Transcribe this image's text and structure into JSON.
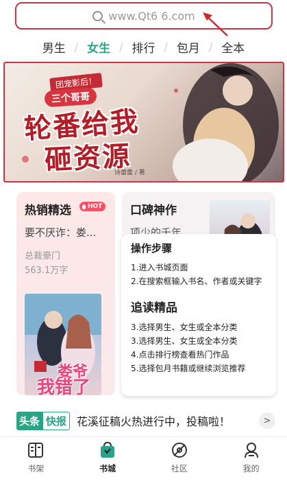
{
  "search": {
    "text": "www.Qt6  6.com"
  },
  "tabs": [
    {
      "label": "男生",
      "active": false
    },
    {
      "label": "女生",
      "active": true
    },
    {
      "label": "排行",
      "active": false
    },
    {
      "label": "包月",
      "active": false
    },
    {
      "label": "全本",
      "active": false
    }
  ],
  "tab_separator": "/",
  "banner": {
    "tag": "团宠影后！",
    "subtitle": "三个哥哥",
    "title_line1": "轮番给我",
    "title_line2": "砸资源",
    "author": "诗蕾蕾 / 著"
  },
  "hot_sales": {
    "title": "热销精选",
    "badge": "HOT",
    "book_title": "要不厌诈：娄...",
    "category": "总裁豪门",
    "word_count": "563.1万字",
    "cover_text_1": "娄爷",
    "cover_text_2": "我错了"
  },
  "word_of_mouth": {
    "title": "口碑神作",
    "book_title": "项少的千年..."
  },
  "guide_panel": {
    "heading1": "操作步骤",
    "steps1": [
      "1.进入书城页面",
      "2.在搜索框输入书名、作者或关键字"
    ],
    "heading2": "追读精品",
    "steps2": [
      "3.选择男生、女生或全本分类",
      "3.选择男生、女生或全本分类",
      "4.点击排行榜查看热门作品",
      "5.选择包月书籍或继续浏览推荐"
    ]
  },
  "news": {
    "badge_1": "头条",
    "badge_2": "快报",
    "text": "花溪征稿火热进行中，投稿啦！",
    "more": ">"
  },
  "bottom_nav": [
    {
      "label": "书架",
      "icon": "bookshelf-icon",
      "active": false
    },
    {
      "label": "书城",
      "icon": "bookstore-icon",
      "active": true
    },
    {
      "label": "社区",
      "icon": "community-icon",
      "active": false
    },
    {
      "label": "我的",
      "icon": "profile-icon",
      "active": false
    }
  ],
  "colors": {
    "accent": "#2aa386",
    "highlight_border": "#c9343d",
    "hot_badge": "#ff4d63"
  }
}
